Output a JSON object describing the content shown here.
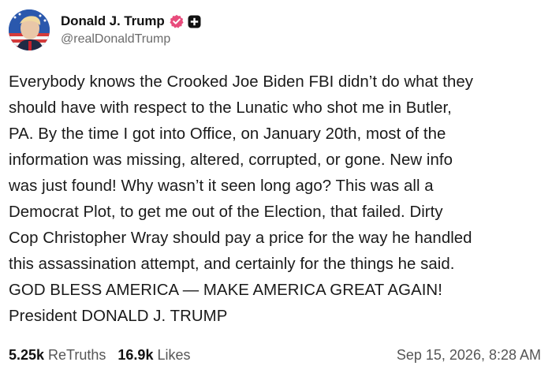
{
  "author": {
    "display_name": "Donald J. Trump",
    "handle": "@realDonaldTrump",
    "verified_icon": "verified-badge-icon",
    "plus_icon": "plus-badge-icon",
    "avatar_icon": "avatar-portrait-icon"
  },
  "post": {
    "text": "Everybody knows the Crooked Joe Biden FBI didn’t do what they\nshould have with respect to the Lunatic who shot me in Butler,\nPA. By the time I got into Office, on January 20th, most of the\ninformation was missing, altered, corrupted, or gone. New info\nwas just found! Why wasn’t it seen long ago? This was all a\nDemocrat Plot, to get me out of the Election, that failed. Dirty\nCop Christopher Wray should pay a price for the way he handled\nthis assassination attempt, and certainly for the things he said.\nGOD BLESS AMERICA — MAKE AMERICA GREAT AGAIN!\nPresident DONALD J. TRUMP"
  },
  "stats": {
    "retruths_count": "5.25k",
    "retruths_label": "ReTruths",
    "likes_count": "16.9k",
    "likes_label": "Likes"
  },
  "timestamp": "Sep 15, 2026, 8:28 AM",
  "colors": {
    "verified": "#e84c7c",
    "text": "#1a1a1a",
    "muted": "#555555"
  }
}
